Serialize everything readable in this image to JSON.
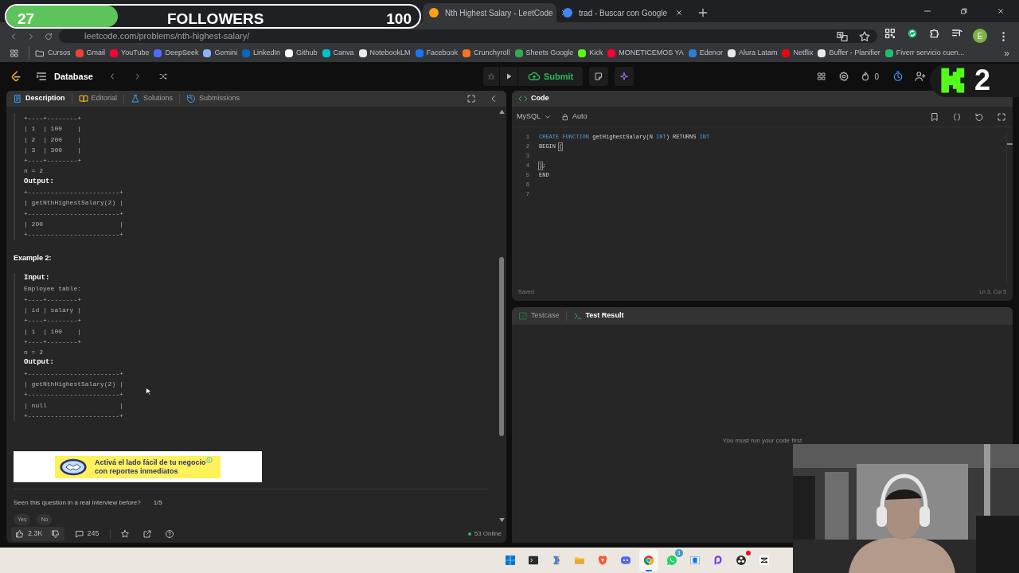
{
  "follower_goal": {
    "current": "27",
    "label": "FOLLOWERS",
    "goal": "100",
    "level": 0.27
  },
  "browser": {
    "tabs": [
      {
        "title": "Nth Highest Salary - LeetCode",
        "selected": true,
        "kind": "leetcode"
      },
      {
        "title": "trad - Buscar con Google",
        "selected": false,
        "kind": "google"
      }
    ],
    "url": "leetcode.com/problems/nth-highest-salary/",
    "profile": "E",
    "bookmarks": [
      {
        "label": "Cursos",
        "kind": "folder"
      },
      {
        "label": "Gmail",
        "kind": "site",
        "color": "#ea4335"
      },
      {
        "label": "YouTube",
        "kind": "site",
        "color": "#ff0033"
      },
      {
        "label": "DeepSeek",
        "kind": "site",
        "color": "#4d6bfe"
      },
      {
        "label": "Gemini",
        "kind": "site",
        "color": "#8ab4f8"
      },
      {
        "label": "LinkedIn",
        "kind": "site",
        "color": "#0a66c2"
      },
      {
        "label": "Github",
        "kind": "site",
        "color": "#ffffff"
      },
      {
        "label": "Canva",
        "kind": "site",
        "color": "#00c4cc"
      },
      {
        "label": "NotebookLM",
        "kind": "site",
        "color": "#e8eaed"
      },
      {
        "label": "Facebook",
        "kind": "site",
        "color": "#1877f2"
      },
      {
        "label": "Crunchyroll",
        "kind": "site",
        "color": "#f47521"
      },
      {
        "label": "Sheets Google",
        "kind": "site",
        "color": "#34a853"
      },
      {
        "label": "Kick",
        "kind": "site",
        "color": "#53fc18"
      },
      {
        "label": "MONETICEMOS YA",
        "kind": "site",
        "color": "#ff0033"
      },
      {
        "label": "Edenor",
        "kind": "site",
        "color": "#2f7fd1"
      },
      {
        "label": "Alura Latam",
        "kind": "site",
        "color": "#e8eaed"
      },
      {
        "label": "Netflix",
        "kind": "site",
        "color": "#e50914"
      },
      {
        "label": "Buffer - Planifier",
        "kind": "site",
        "color": "#e8eaed"
      },
      {
        "label": "Fiverr servicio cuen...",
        "kind": "site",
        "color": "#1dbf73"
      }
    ],
    "more": "»"
  },
  "nav": {
    "section": "Database",
    "submit": "Submit",
    "streak": "0"
  },
  "stream_badge": {
    "text": "2"
  },
  "description": {
    "tabs": [
      {
        "label": "Description",
        "selected": true,
        "kind": "doc"
      },
      {
        "label": "Editorial",
        "selected": false,
        "kind": "book"
      },
      {
        "label": "Solutions",
        "selected": false,
        "kind": "flask"
      },
      {
        "label": "Submissions",
        "selected": false,
        "kind": "history"
      }
    ],
    "blocks": [
      {
        "kind": "example",
        "lines": [
          {
            "kind": "code",
            "text": "+----+--------+"
          },
          {
            "kind": "code",
            "text": "| 1  | 100    |"
          },
          {
            "kind": "code",
            "text": "| 2  | 200    |"
          },
          {
            "kind": "code",
            "text": "| 3  | 300    |"
          },
          {
            "kind": "code",
            "text": "+----+--------+"
          },
          {
            "kind": "code",
            "text": "n = 2"
          },
          {
            "kind": "label",
            "text": "Output:"
          },
          {
            "kind": "code",
            "text": "+------------------------+"
          },
          {
            "kind": "code",
            "text": "| getNthHighestSalary(2) |"
          },
          {
            "kind": "code",
            "text": "+------------------------+"
          },
          {
            "kind": "code",
            "text": "| 200                    |"
          },
          {
            "kind": "code",
            "text": "+------------------------+"
          }
        ]
      },
      {
        "kind": "heading",
        "text": "Example 2:"
      },
      {
        "kind": "example",
        "lines": [
          {
            "kind": "label",
            "text": "Input:"
          },
          {
            "kind": "code",
            "text": "Employee table:"
          },
          {
            "kind": "code",
            "text": "+----+--------+"
          },
          {
            "kind": "code",
            "text": "| id | salary |"
          },
          {
            "kind": "code",
            "text": "+----+--------+"
          },
          {
            "kind": "code",
            "text": "| 1  | 100    |"
          },
          {
            "kind": "code",
            "text": "+----+--------+"
          },
          {
            "kind": "code",
            "text": "n = 2"
          },
          {
            "kind": "label",
            "text": "Output:"
          },
          {
            "kind": "code",
            "text": "+------------------------+"
          },
          {
            "kind": "code",
            "text": "| getNthHighestSalary(2) |"
          },
          {
            "kind": "code",
            "text": "+------------------------+"
          },
          {
            "kind": "code",
            "text": "| null                   |"
          },
          {
            "kind": "code",
            "text": "+------------------------+"
          }
        ]
      }
    ],
    "ad": {
      "lines": [
        "Activá el lado fácil de tu negocio",
        "con reportes inmediatos"
      ]
    },
    "interview_question": "Seen this question in a real interview before?",
    "interview_count": "1/5",
    "answers": [
      "Yes",
      "No"
    ],
    "likes": "2.3K",
    "comments": "245",
    "online": "53 Online"
  },
  "code": {
    "title": "Code",
    "language": "MySQL",
    "mode": "Auto",
    "lines": [
      {
        "number": "1",
        "tokens": [
          {
            "text": "CREATE FUNCTION",
            "kind": "keyword"
          },
          {
            "text": " getHighestSalary(N ",
            "kind": "plain"
          },
          {
            "text": "INT",
            "kind": "keyword"
          },
          {
            "text": ") RETURNS ",
            "kind": "plain"
          },
          {
            "text": "INT",
            "kind": "keyword"
          }
        ]
      },
      {
        "number": "2",
        "tokens": [
          {
            "text": "BEGIN ",
            "kind": "plain"
          },
          {
            "text": "(",
            "kind": "bracket"
          }
        ]
      },
      {
        "number": "3"
      },
      {
        "number": "4",
        "tokens": [
          {
            "text": ")",
            "kind": "bracket"
          },
          {
            "text": ";",
            "kind": "plain"
          }
        ]
      },
      {
        "number": "5",
        "tokens": [
          {
            "text": "END",
            "kind": "plain"
          }
        ]
      },
      {
        "number": "6"
      },
      {
        "number": "7"
      }
    ],
    "status": "Saved",
    "position": "Ln 3, Col 5"
  },
  "results": {
    "tabs": [
      {
        "label": "Testcase",
        "selected": false,
        "kind": "check"
      },
      {
        "label": "Test Result",
        "selected": true,
        "kind": "terminal"
      }
    ],
    "message": "You must run your code first"
  },
  "taskbar": [
    {
      "kind": "windows"
    },
    {
      "kind": "terminal"
    },
    {
      "kind": "copilot"
    },
    {
      "kind": "folder"
    },
    {
      "kind": "brave"
    },
    {
      "kind": "discord"
    },
    {
      "kind": "chrome",
      "selected": true
    },
    {
      "kind": "whatsapp",
      "badge": "3"
    },
    {
      "kind": "window"
    },
    {
      "kind": "arc"
    },
    {
      "kind": "obs",
      "alert": true
    },
    {
      "kind": "capcut"
    }
  ]
}
